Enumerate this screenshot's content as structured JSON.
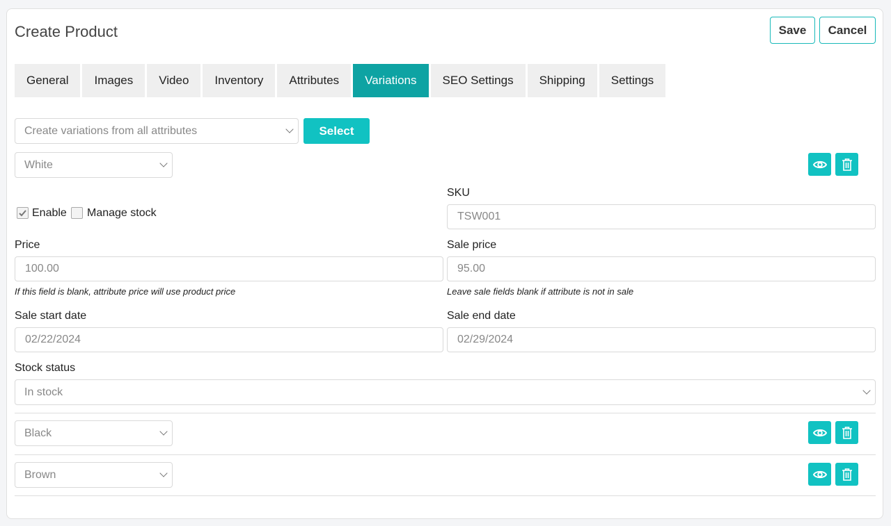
{
  "header": {
    "title": "Create Product",
    "save_label": "Save",
    "cancel_label": "Cancel"
  },
  "tabs": [
    "General",
    "Images",
    "Video",
    "Inventory",
    "Attributes",
    "Variations",
    "SEO Settings",
    "Shipping",
    "Settings"
  ],
  "active_tab": "Variations",
  "create": {
    "placeholder": "Create variations from all attributes",
    "select_label": "Select"
  },
  "variation_open": {
    "name": "White",
    "enable_label": "Enable",
    "manage_stock_label": "Manage stock",
    "sku_label": "SKU",
    "sku_value": "TSW001",
    "price_label": "Price",
    "price_value": "100.00",
    "price_hint": "If this field is blank, attribute price will use product price",
    "sale_price_label": "Sale price",
    "sale_price_value": "95.00",
    "sale_hint": "Leave sale fields blank if attribute is not in sale",
    "sale_start_label": "Sale start date",
    "sale_start_value": "02/22/2024",
    "sale_end_label": "Sale end date",
    "sale_end_value": "02/29/2024",
    "stock_status_label": "Stock status",
    "stock_status_value": "In stock"
  },
  "variations_collapsed": [
    "Black",
    "Brown"
  ],
  "icons": {
    "view": "eye-icon",
    "delete": "trash-icon",
    "check": "checkmark-icon"
  },
  "colors": {
    "accent": "#11c2c2",
    "tab_active": "#0ea3a3"
  }
}
